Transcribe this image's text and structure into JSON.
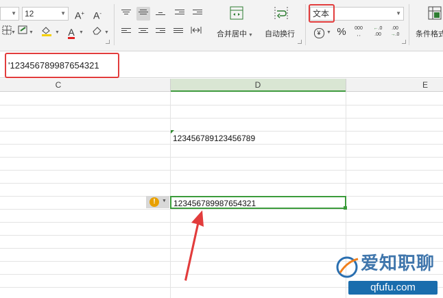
{
  "ribbon": {
    "font_size_value": "12",
    "grow_font_icon": "A⁺",
    "shrink_font_icon": "A⁻",
    "merge_center_label": "合并居中",
    "wrap_text_label": "自动换行",
    "number_format_value": "文本",
    "percent_symbol": "%",
    "inc_decimal_label": "+.0 .00",
    "dec_decimal_label": "+.0 .00",
    "thousands_label": "000",
    "conditional_format_label": "条件格式"
  },
  "formula_bar": {
    "content": "'123456789987654321"
  },
  "columns": [
    "C",
    "D",
    "E"
  ],
  "cells": {
    "d_row_1": "123456789123456789",
    "d_active": "123456789987654321"
  },
  "annotations": {
    "highlight_color": "#e23c3c",
    "arrow_color": "#e23c3c"
  },
  "watermark": {
    "title": "爱知职聊",
    "url": "qfufu.com"
  },
  "colors": {
    "active_border": "#3b9b3b",
    "warning": "#e8a000"
  }
}
